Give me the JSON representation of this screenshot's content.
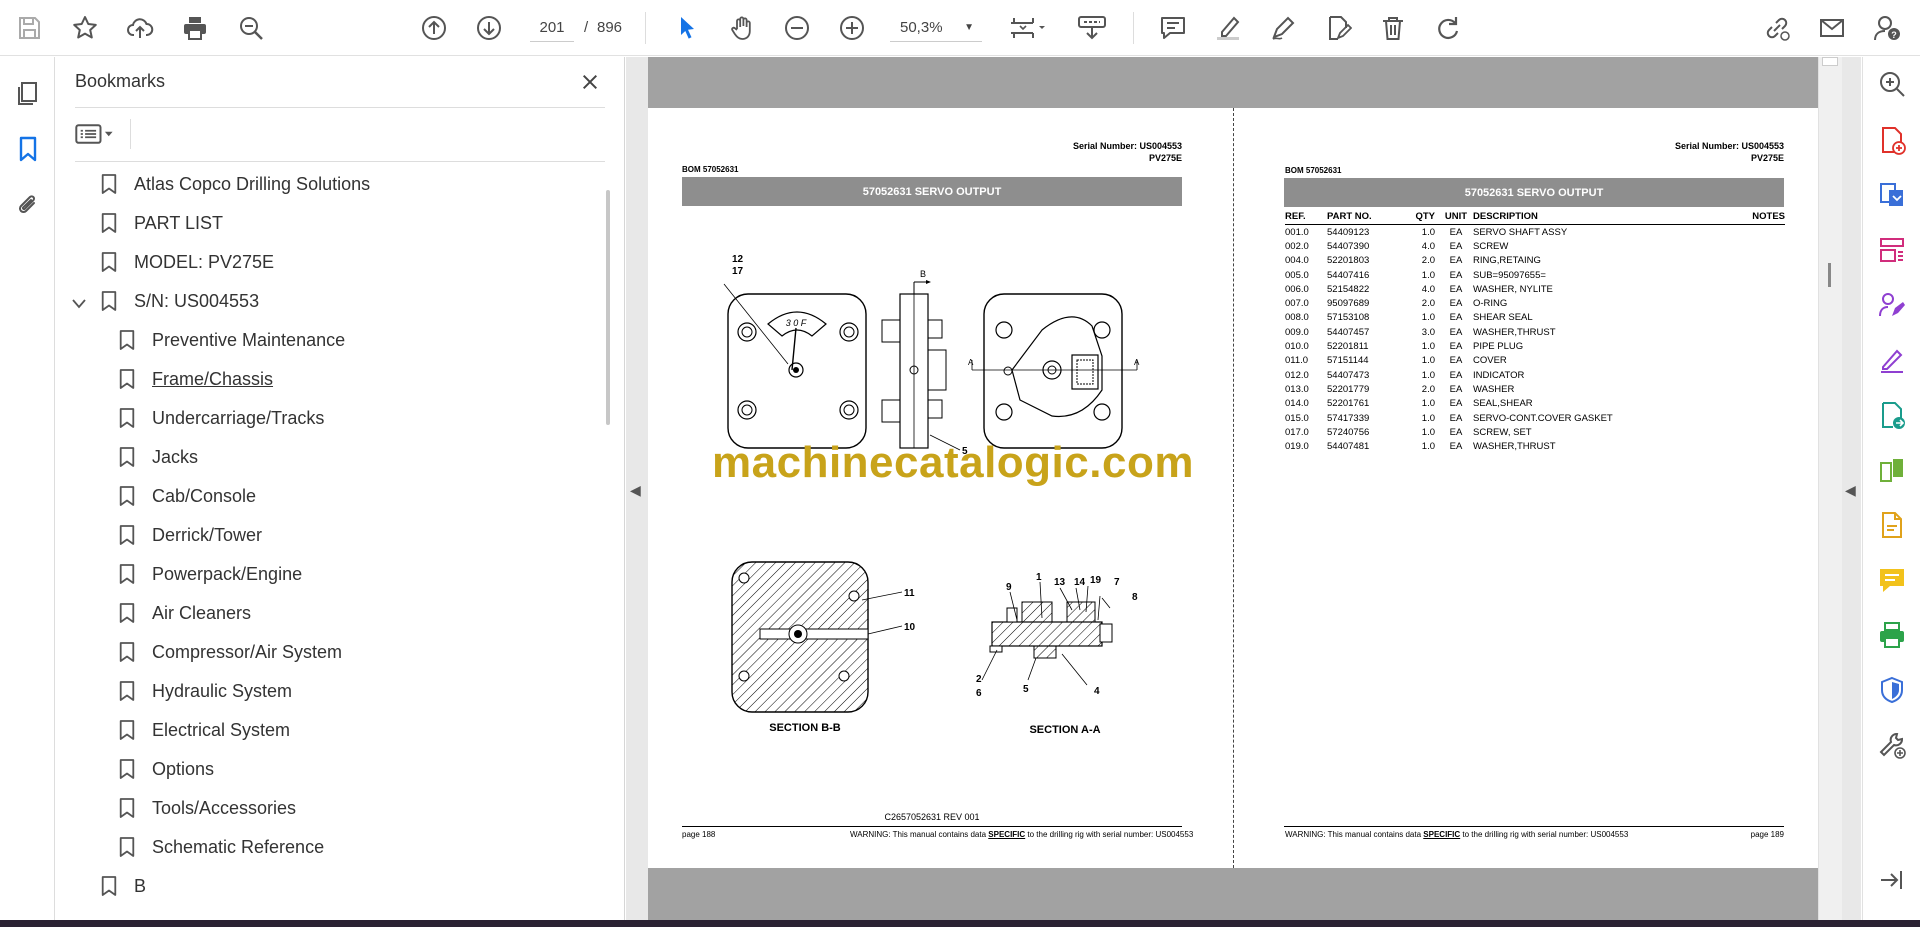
{
  "toolbar": {
    "current_page": "201",
    "page_separator": "/",
    "total_pages": "896",
    "zoom": "50,3%"
  },
  "bookmarks": {
    "title": "Bookmarks",
    "items": [
      {
        "label": "Atlas Copco Drilling Solutions",
        "level": 0
      },
      {
        "label": "PART LIST",
        "level": 0
      },
      {
        "label": "MODEL: PV275E",
        "level": 0
      },
      {
        "label": "S/N: US004553",
        "level": 0,
        "expanded": true
      },
      {
        "label": "Preventive Maintenance",
        "level": 1
      },
      {
        "label": "Frame/Chassis",
        "level": 1,
        "hovered": true
      },
      {
        "label": "Undercarriage/Tracks",
        "level": 1
      },
      {
        "label": "Jacks",
        "level": 1
      },
      {
        "label": "Cab/Console",
        "level": 1
      },
      {
        "label": "Derrick/Tower",
        "level": 1
      },
      {
        "label": "Powerpack/Engine",
        "level": 1
      },
      {
        "label": "Air Cleaners",
        "level": 1
      },
      {
        "label": "Compressor/Air System",
        "level": 1
      },
      {
        "label": "Hydraulic System",
        "level": 1
      },
      {
        "label": "Electrical System",
        "level": 1
      },
      {
        "label": "Options",
        "level": 1
      },
      {
        "label": "Tools/Accessories",
        "level": 1
      },
      {
        "label": "Schematic Reference",
        "level": 1
      },
      {
        "label": "B",
        "level": 0
      }
    ]
  },
  "left_page": {
    "serial_number": "Serial Number: US004553",
    "model": "PV275E",
    "bom": "BOM 57052631",
    "header": "57052631 SERVO OUTPUT",
    "drawing_labels": {
      "l12": "12",
      "l17": "17",
      "lB": "B",
      "lA1": "A",
      "lA2": "A",
      "l5": "5",
      "l11": "11",
      "l10": "10",
      "l9": "9",
      "l1": "1",
      "l13": "13",
      "l14": "14",
      "l19": "19",
      "l7": "7",
      "l8": "8",
      "l2": "2",
      "l6": "6",
      "l5b": "5",
      "l4": "4",
      "gauge": "3 0 F"
    },
    "section_bb": "SECTION B-B",
    "section_aa": "SECTION A-A",
    "doc_ref": "C2657052631 REV 001",
    "page_no": "page 188",
    "warning_pre": "WARNING:  This manual contains data ",
    "warning_specific": "SPECIFIC",
    "warning_post": " to the drilling rig with serial number: US004553"
  },
  "right_page": {
    "serial_number": "Serial Number: US004553",
    "model": "PV275E",
    "bom": "BOM 57052631",
    "header": "57052631 SERVO OUTPUT",
    "columns": {
      "ref": "REF.",
      "part": "PART NO.",
      "qty": "QTY",
      "unit": "UNIT",
      "desc": "DESCRIPTION",
      "notes": "NOTES"
    },
    "rows": [
      {
        "ref": "001.0",
        "part": "54409123",
        "qty": "1.0",
        "unit": "EA",
        "desc": "SERVO SHAFT ASSY"
      },
      {
        "ref": "002.0",
        "part": "54407390",
        "qty": "4.0",
        "unit": "EA",
        "desc": "SCREW"
      },
      {
        "ref": "004.0",
        "part": "52201803",
        "qty": "2.0",
        "unit": "EA",
        "desc": "RING,RETAING"
      },
      {
        "ref": "005.0",
        "part": "54407416",
        "qty": "1.0",
        "unit": "EA",
        "desc": "SUB=95097655="
      },
      {
        "ref": "006.0",
        "part": "52154822",
        "qty": "4.0",
        "unit": "EA",
        "desc": "WASHER, NYLITE"
      },
      {
        "ref": "007.0",
        "part": "95097689",
        "qty": "2.0",
        "unit": "EA",
        "desc": "O-RING"
      },
      {
        "ref": "008.0",
        "part": "57153108",
        "qty": "1.0",
        "unit": "EA",
        "desc": "SHEAR SEAL"
      },
      {
        "ref": "009.0",
        "part": "54407457",
        "qty": "3.0",
        "unit": "EA",
        "desc": "WASHER,THRUST"
      },
      {
        "ref": "010.0",
        "part": "52201811",
        "qty": "1.0",
        "unit": "EA",
        "desc": "PIPE PLUG"
      },
      {
        "ref": "011.0",
        "part": "57151144",
        "qty": "1.0",
        "unit": "EA",
        "desc": "COVER"
      },
      {
        "ref": "012.0",
        "part": "54407473",
        "qty": "1.0",
        "unit": "EA",
        "desc": "INDICATOR"
      },
      {
        "ref": "013.0",
        "part": "52201779",
        "qty": "2.0",
        "unit": "EA",
        "desc": "WASHER"
      },
      {
        "ref": "014.0",
        "part": "52201761",
        "qty": "1.0",
        "unit": "EA",
        "desc": "SEAL,SHEAR"
      },
      {
        "ref": "015.0",
        "part": "57417339",
        "qty": "1.0",
        "unit": "EA",
        "desc": "SERVO-CONT.COVER GASKET"
      },
      {
        "ref": "017.0",
        "part": "57240756",
        "qty": "1.0",
        "unit": "EA",
        "desc": "SCREW, SET"
      },
      {
        "ref": "019.0",
        "part": "54407481",
        "qty": "1.0",
        "unit": "EA",
        "desc": "WASHER,THRUST"
      }
    ],
    "page_no": "page 189",
    "warning_pre": "WARNING:  This manual contains data ",
    "warning_specific": "SPECIFIC",
    "warning_post": " to the drilling rig with serial number: US004553"
  },
  "watermark": "machinecatalogic.com",
  "colors": {
    "accent": "#1473e6",
    "header_bar": "#8e8e8e",
    "watermark": "#c8a31a"
  }
}
